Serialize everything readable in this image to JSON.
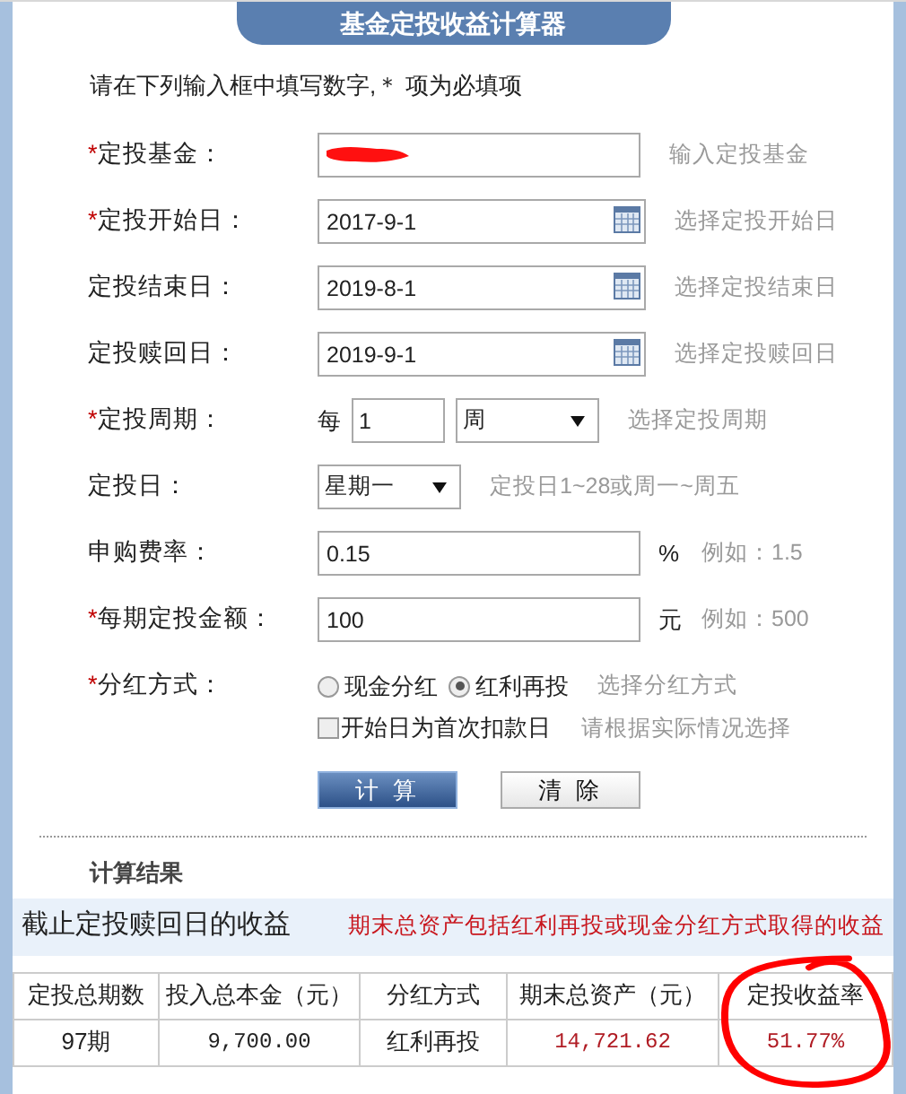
{
  "title": "基金定投收益计算器",
  "instruction": "请在下列输入框中填写数字,＊ 项为必填项",
  "fields": [
    {
      "kind": "text",
      "mark": "*",
      "label": "定投基金：",
      "redacted": true,
      "hint": "输入定投基金"
    },
    {
      "kind": "date",
      "mark": "*",
      "label": "定投开始日：",
      "value": "2017-9-1",
      "hint": "选择定投开始日"
    },
    {
      "kind": "date",
      "label": "定投结束日：",
      "value": "2019-8-1",
      "hint": "选择定投结束日"
    },
    {
      "kind": "date",
      "label": "定投赎回日：",
      "value": "2019-9-1",
      "hint": "选择定投赎回日"
    },
    {
      "kind": "period",
      "mark": "*",
      "label": "定投周期：",
      "prefix": "每",
      "value": "1",
      "unit": "周",
      "hint": "选择定投周期"
    },
    {
      "kind": "select",
      "label": "定投日：",
      "value": "星期一",
      "hint": "定投日1~28或周一~周五"
    },
    {
      "kind": "text",
      "label": "申购费率：",
      "value": "0.15",
      "suffix": "%",
      "hint": "例如：1.5"
    },
    {
      "kind": "text",
      "mark": "*",
      "label": "每期定投金额：",
      "value": "100",
      "suffix": "元",
      "hint": "例如：500"
    },
    {
      "kind": "radio",
      "mark": "*",
      "label": "分红方式：",
      "options": [
        {
          "label": "现金分红",
          "selected": false
        },
        {
          "label": "红利再投",
          "selected": true
        }
      ],
      "hint": "选择分红方式"
    }
  ],
  "checkbox": {
    "label": "开始日为首次扣款日",
    "checked": false,
    "hint": "请根据实际情况选择"
  },
  "buttons": [
    {
      "label": "计 算",
      "kind": "primary"
    },
    {
      "label": "清 除",
      "kind": "secondary"
    }
  ],
  "results": {
    "heading": "计算结果",
    "subtitle": "截止定投赎回日的收益",
    "note": "期末总资产包括红利再投或现金分红方式取得的收益",
    "columns": [
      "定投总期数",
      "投入总本金（元）",
      "分红方式",
      "期末总资产（元）",
      "定投收益率"
    ],
    "rows": [
      [
        {
          "text": "97期"
        },
        {
          "text": "9,700.00",
          "mono": true
        },
        {
          "text": "红利再投"
        },
        {
          "text": "14,721.62",
          "mono": true,
          "red": true
        },
        {
          "text": "51.77%",
          "mono": true,
          "red": true
        }
      ]
    ]
  },
  "annotation": {
    "kind": "circle"
  }
}
